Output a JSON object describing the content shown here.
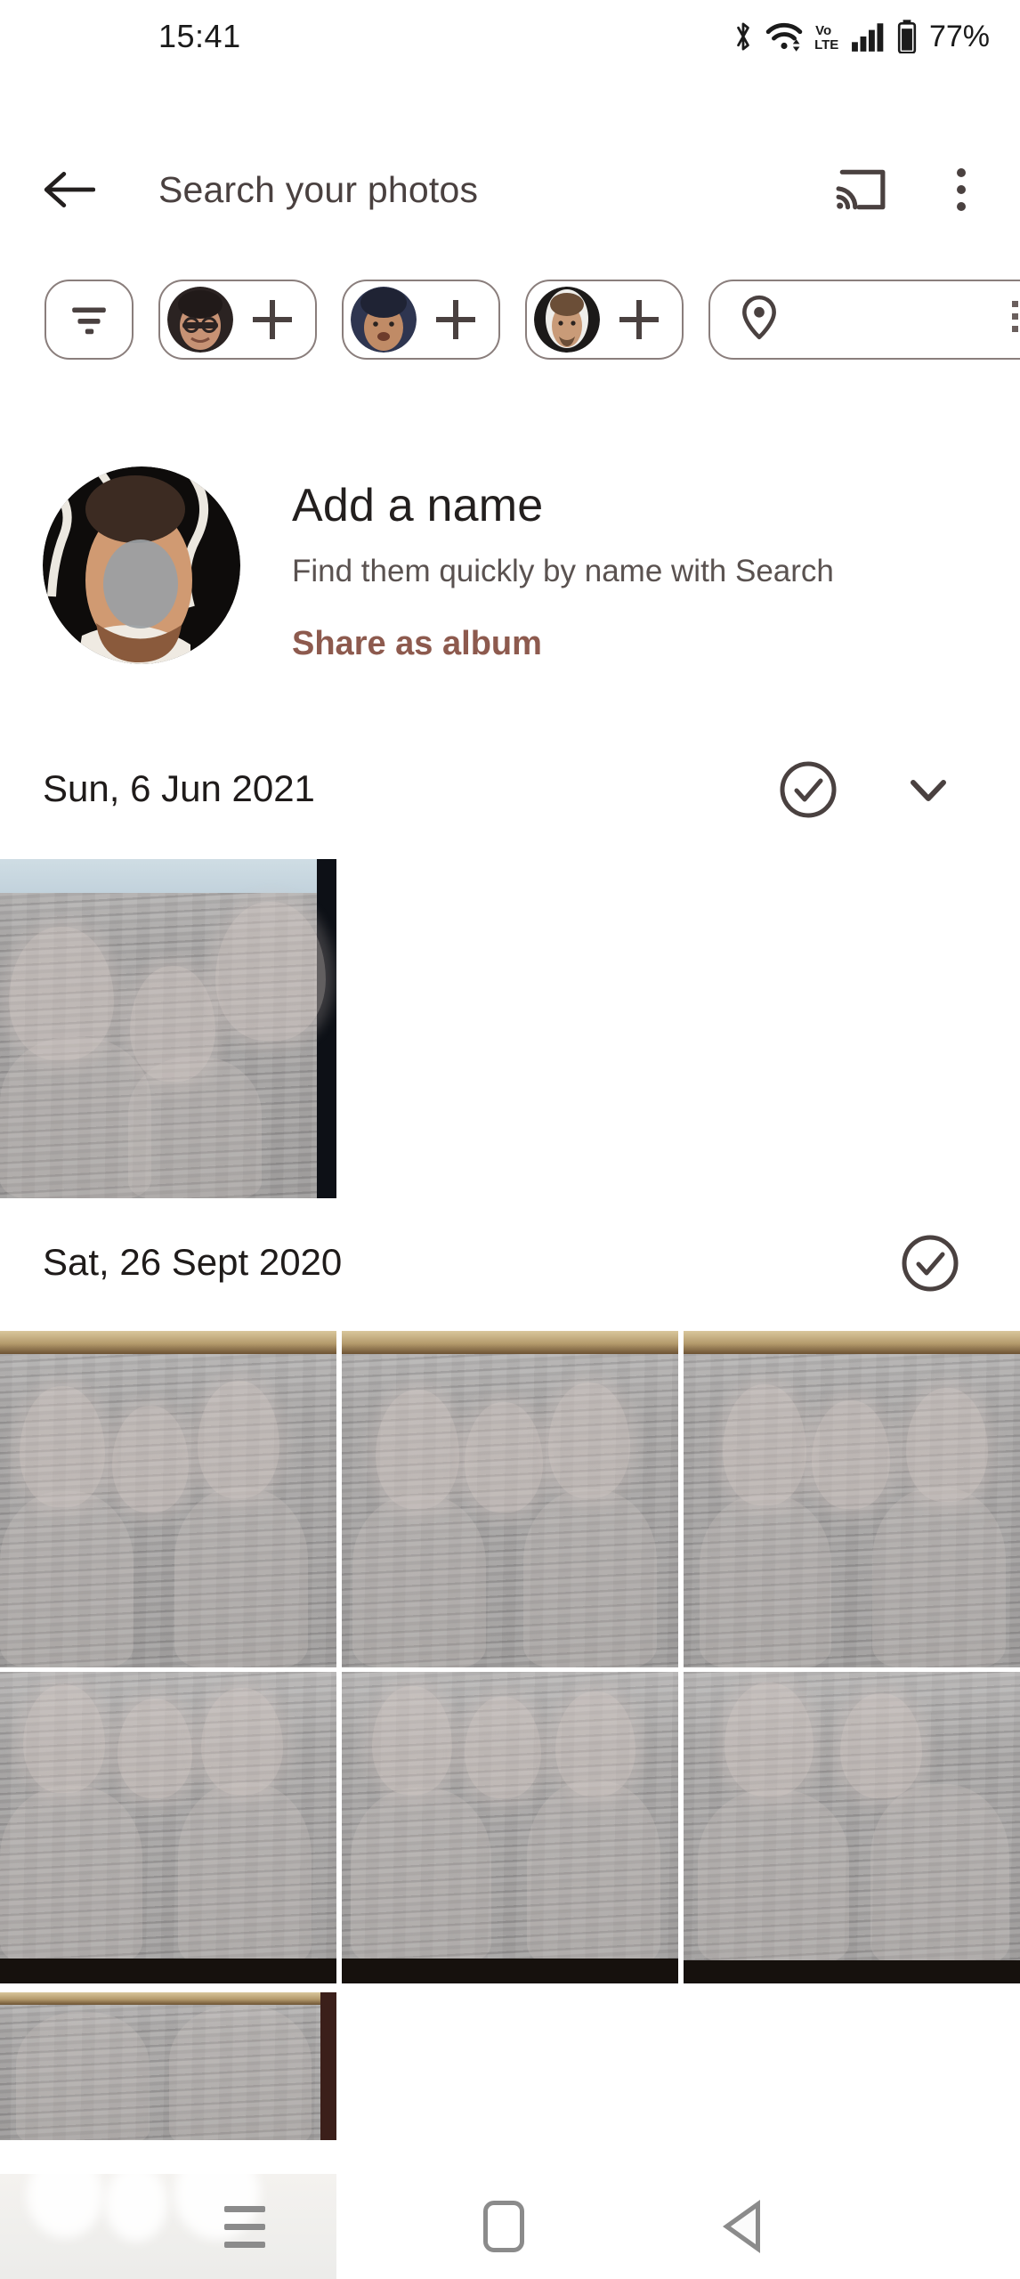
{
  "status_bar": {
    "time": "15:41",
    "battery_percent": "77%",
    "icons": [
      "bluetooth-icon",
      "wifi-icon",
      "volte-icon",
      "signal-icon",
      "battery-icon"
    ]
  },
  "search_bar": {
    "back_icon": "back-arrow-icon",
    "placeholder": "Search your photos",
    "cast_icon": "cast-icon",
    "overflow_icon": "overflow-menu-icon"
  },
  "filter_chips": [
    {
      "id": "filter",
      "icon": "tune-filter-icon",
      "label": ""
    },
    {
      "id": "face-1",
      "icon": "face-avatar-icon",
      "action_icon": "plus-icon",
      "label": ""
    },
    {
      "id": "face-2",
      "icon": "face-avatar-icon",
      "action_icon": "plus-icon",
      "label": ""
    },
    {
      "id": "face-3",
      "icon": "face-avatar-icon",
      "action_icon": "plus-icon",
      "label": ""
    },
    {
      "id": "location",
      "icon": "location-pin-icon",
      "label": ""
    }
  ],
  "person_card": {
    "avatar": "person-avatar",
    "title": "Add a name",
    "subtitle": "Find them quickly by name with Search",
    "share_link": "Share as album",
    "share_link_color": "#8d5a4e"
  },
  "sections": [
    {
      "date": "Sun, 6 Jun 2021",
      "select_icon": "check-circle-icon",
      "expand_icon": "chevron-down-icon",
      "has_expand": true,
      "photo_count": 1
    },
    {
      "date": "Sat, 26 Sept 2020",
      "select_icon": "check-circle-icon",
      "has_expand": false,
      "photo_count": 7
    }
  ],
  "nav_bar": {
    "recents_icon": "recents-icon",
    "home_icon": "home-icon",
    "back_icon": "back-nav-icon"
  },
  "colors": {
    "accent": "#8d5a4e",
    "icon": "#4a4140",
    "text": "#1f1b1a",
    "chip_border": "#8a7e7c",
    "nav_icon": "#8b8b8b"
  }
}
